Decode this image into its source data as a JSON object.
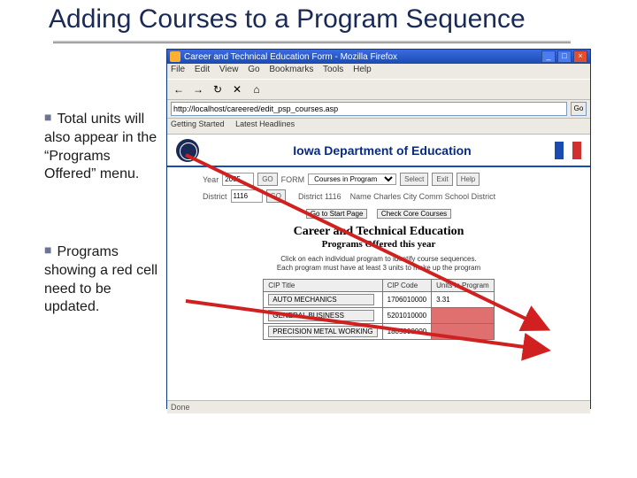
{
  "slide": {
    "title": "Adding Courses to a Program Sequence",
    "bullet1": "Total units will also appear in the “Programs Offered” menu.",
    "bullet2": "Programs showing a red cell need to be updated."
  },
  "window": {
    "title": "Career and Technical Education Form - Mozilla Firefox",
    "min": "_",
    "max": "□",
    "close": "×",
    "menu": {
      "file": "File",
      "edit": "Edit",
      "view": "View",
      "go": "Go",
      "bookmarks": "Bookmarks",
      "tools": "Tools",
      "help": "Help"
    },
    "toolbar": {
      "back": "←",
      "fwd": "→",
      "reload": "↻",
      "stop": "✕",
      "home": "⌂"
    },
    "address": "http://localhost/careered/edit_psp_courses.asp",
    "go_label": "Go",
    "bookmarks_bar": {
      "gs": "Getting Started",
      "lh": "Latest Headlines"
    }
  },
  "page": {
    "header": "Iowa Department of Education",
    "form": {
      "year_label": "Year",
      "year_value": "2005",
      "go": "GO",
      "form_label": "FORM",
      "form_value": "Courses in Program",
      "select": "Select",
      "exit": "Exit",
      "help": "Help",
      "district_label": "District",
      "district_value": "1116",
      "go2": "GO",
      "district_no": "District 1116",
      "district_name": "Name Charles City Comm School District"
    },
    "goto": {
      "start": "Go to Start Page",
      "core": "Check Core Courses"
    },
    "cte_title": "Career and Technical Education",
    "cte_sub": "Programs Offered this year",
    "instructions_line1": "Click on each individual program to identify course sequences.",
    "instructions_line2": "Each program must have at least 3 units to make up the program",
    "table": {
      "h1": "CIP Title",
      "h2": "CIP Code",
      "h3": "Units in Program",
      "rows": [
        {
          "title": "AUTO MECHANICS",
          "code": "1706010000",
          "units": "3.31",
          "red": false
        },
        {
          "title": "GENERAL BUSINESS",
          "code": "5201010000",
          "units": "",
          "red": true
        },
        {
          "title": "PRECISION METAL WORKING",
          "code": "1805000000",
          "units": "",
          "red": true
        }
      ]
    }
  },
  "status": "Done"
}
